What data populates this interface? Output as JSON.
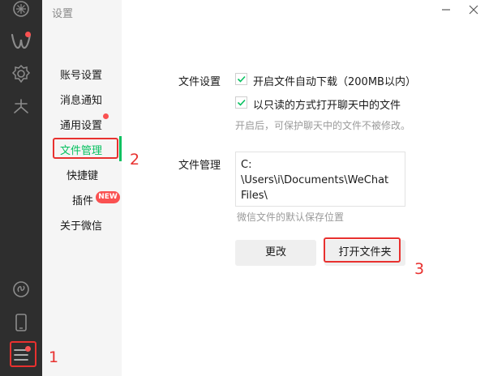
{
  "window": {
    "title": "设置"
  },
  "nav": {
    "items": [
      {
        "label": "账号设置"
      },
      {
        "label": "消息通知"
      },
      {
        "label": "通用设置"
      },
      {
        "label": "文件管理"
      },
      {
        "label": "快捷键"
      },
      {
        "label": "插件"
      },
      {
        "label": "关于微信"
      }
    ],
    "new_badge": "NEW"
  },
  "rail_icons": [
    "chats-icon",
    "moments-icon",
    "settings-gear-icon",
    "sparkle-icon",
    "mini-program-icon",
    "phone-icon",
    "menu-icon"
  ],
  "file_settings": {
    "label": "文件设置",
    "options": [
      {
        "label": "开启文件自动下载（200MB以内）",
        "checked": true
      },
      {
        "label": "以只读的方式打开聊天中的文件",
        "checked": true
      }
    ],
    "hint": "开启后，可保护聊天中的文件不被修改。"
  },
  "file_management": {
    "label": "文件管理",
    "path_lines": [
      "C:",
      "\\Users\\i\\Documents\\WeChat",
      "Files\\"
    ],
    "hint": "微信文件的默认保存位置",
    "change_button": "更改",
    "open_folder_button": "打开文件夹"
  },
  "annotations": [
    "1",
    "2",
    "3"
  ],
  "colors": {
    "accent": "#07c160",
    "badge": "#fa5151",
    "annotation": "#e8312f",
    "rail": "#2e2e2e"
  }
}
